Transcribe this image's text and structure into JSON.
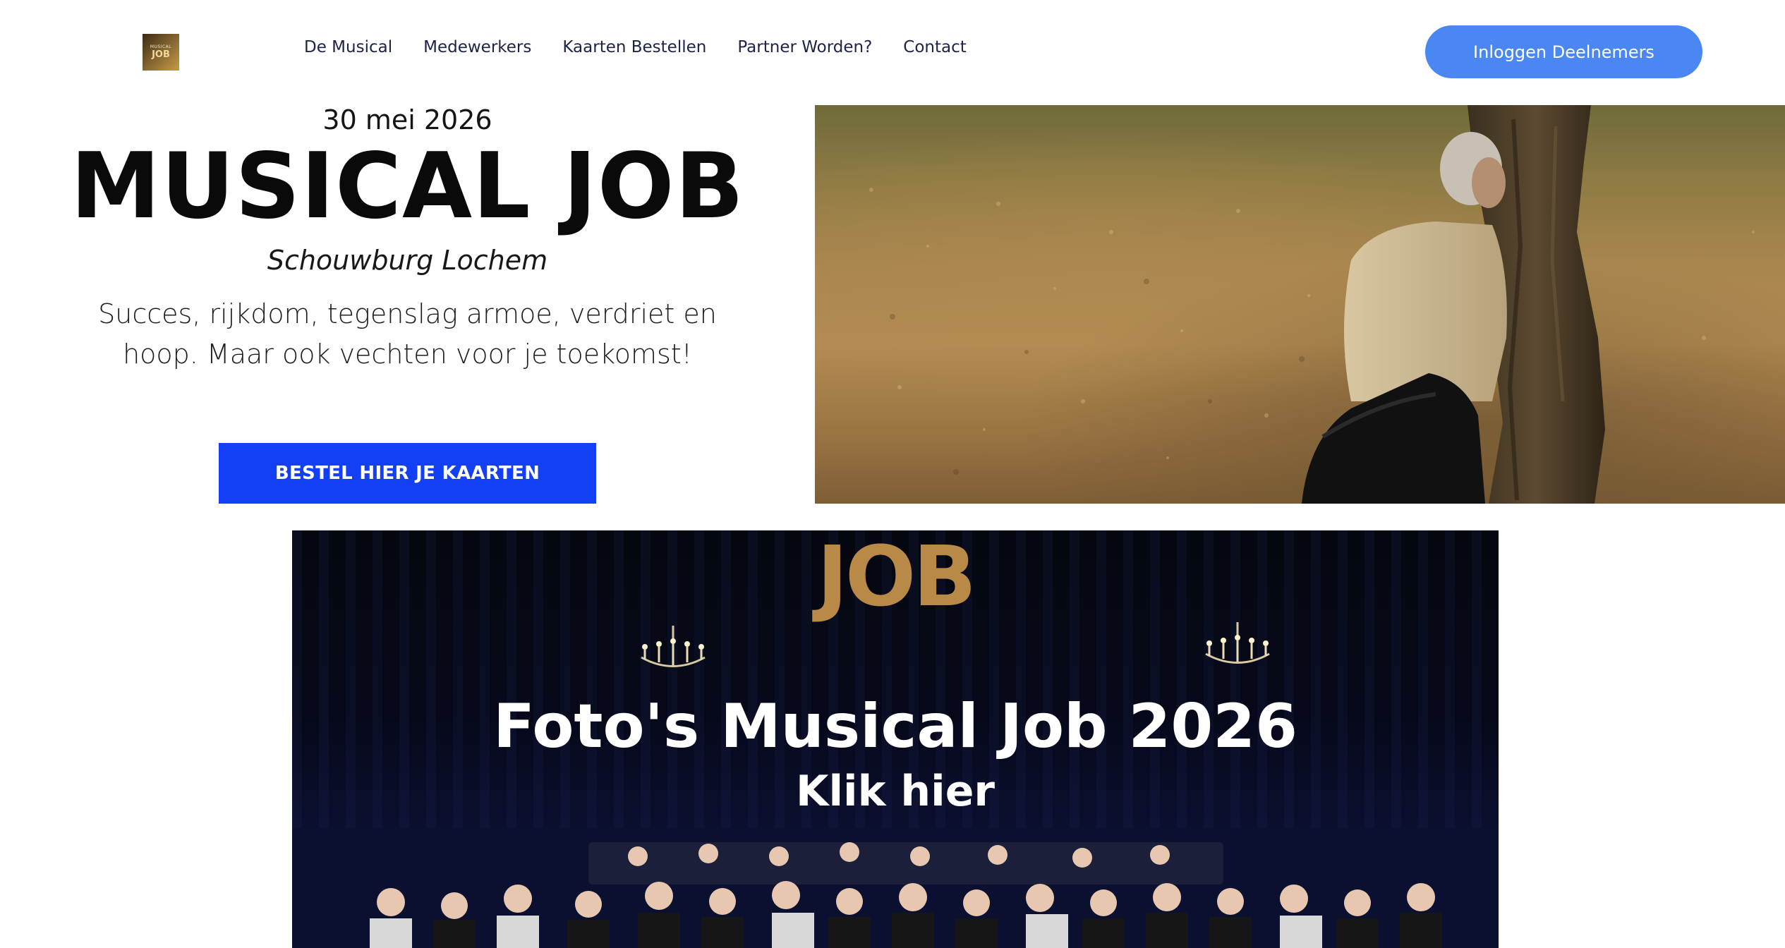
{
  "header": {
    "logo": {
      "line1": "MUSICAL",
      "line2": "JOB"
    },
    "nav": [
      {
        "label": "De Musical"
      },
      {
        "label": "Medewerkers"
      },
      {
        "label": "Kaarten Bestellen"
      },
      {
        "label": "Partner Worden?"
      },
      {
        "label": "Contact"
      }
    ],
    "login_label": "Inloggen Deelnemers"
  },
  "hero": {
    "date": "30 mei 2026",
    "title": "MUSICAL JOB",
    "venue": "Schouwburg Lochem",
    "tagline": "Succes, rijkdom, tegenslag armoe, verdriet en hoop. Maar ook vechten voor je toekomst!",
    "cta_label": "BESTEL HIER JE KAARTEN"
  },
  "banner": {
    "logo_text": "JOB",
    "heading": "Foto's Musical Job 2026",
    "subheading": "Klik hier"
  },
  "colors": {
    "login_button": "#4a87f3",
    "cta_button": "#1440f5",
    "nav_text": "#1c2348",
    "banner_logo": "#b98a47"
  }
}
